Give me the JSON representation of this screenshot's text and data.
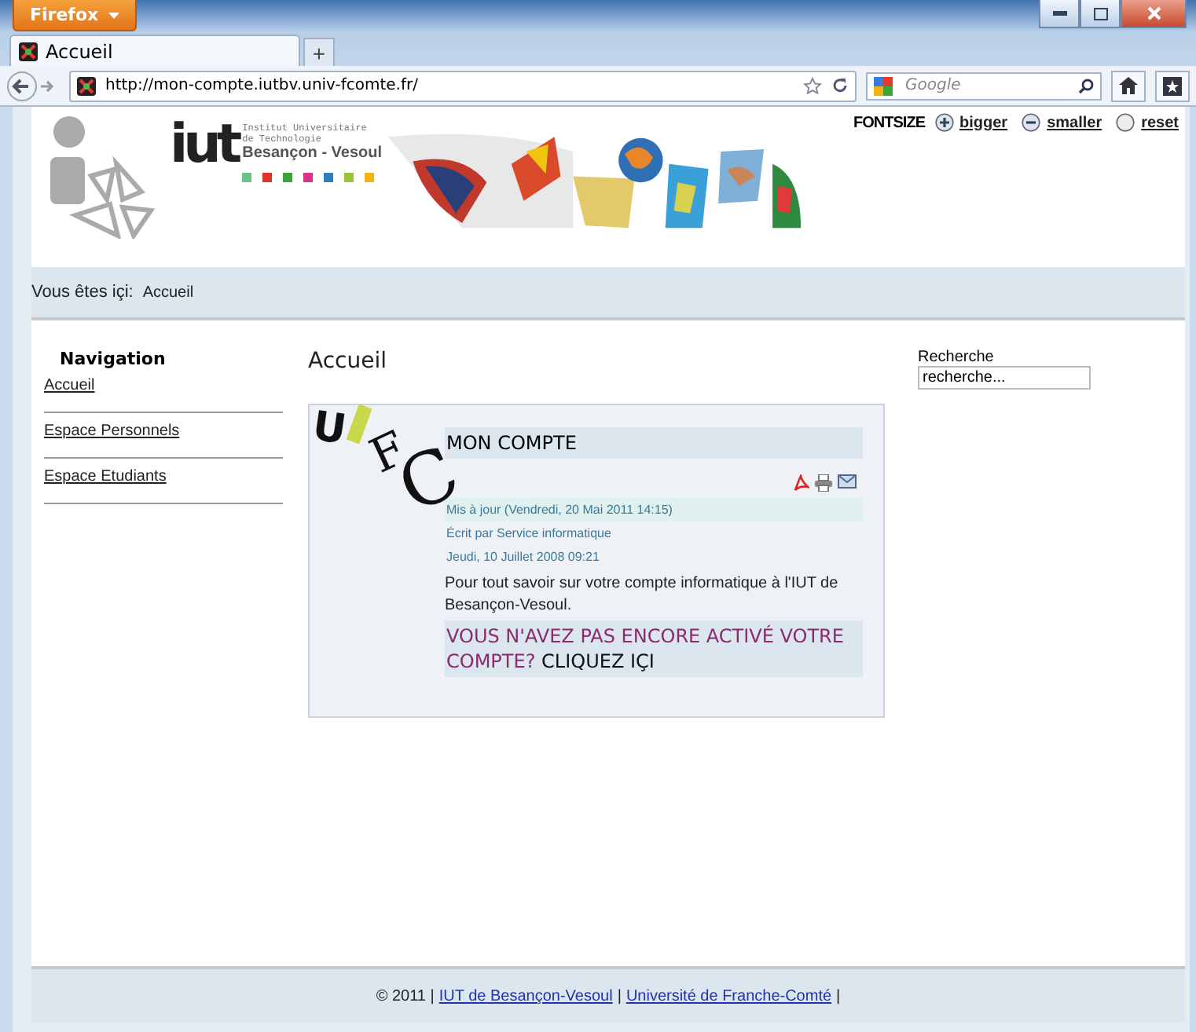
{
  "browser": {
    "menu_button": "Firefox",
    "tabs": [
      {
        "label": "Accueil",
        "selected": true
      }
    ],
    "new_tab": "+",
    "url": "http://mon-compte.iutbv.univ-fcomte.fr/",
    "search": {
      "placeholder": "Google"
    }
  },
  "header": {
    "logo": {
      "letters": "iut",
      "lines": [
        "Institut Universitaire",
        "de Technologie"
      ],
      "city": "Besançon - Vesoul"
    },
    "fontsize": {
      "label": "FONTSIZE",
      "options": [
        {
          "kind": "plus",
          "label": "bigger"
        },
        {
          "kind": "minus",
          "label": "smaller"
        },
        {
          "kind": "reset",
          "label": "reset"
        }
      ]
    }
  },
  "breadcrumb": {
    "label": "Vous êtes içi:",
    "current": "Accueil"
  },
  "navigation": {
    "title": "Navigation",
    "items": [
      "Accueil",
      "Espace Personnels",
      "Espace Etudiants"
    ]
  },
  "main": {
    "title": "Accueil",
    "article": {
      "logo_letters": [
        "U",
        "F",
        "C"
      ],
      "title": "MON COMPTE",
      "updated": "Mis à jour (Vendredi, 20 Mai 2011 14:15)",
      "author": "Écrit par Service informatique",
      "date": "Jeudi, 10 Juillet 2008 09:21",
      "body": "Pour tout savoir sur votre compte informatique à l'IUT de Besançon-Vesoul.",
      "notice": "VOUS N'AVEZ  PAS ENCORE ACTIVÉ VOTRE COMPTE?",
      "link": "CLIQUEZ IÇI"
    }
  },
  "search": {
    "label": "Recherche",
    "value": "recherche..."
  },
  "footer": {
    "copyright": "© 2011 |",
    "links": [
      "IUT de Besançon-Vesoul",
      "Université de Franche-Comté"
    ],
    "separator": "|"
  }
}
